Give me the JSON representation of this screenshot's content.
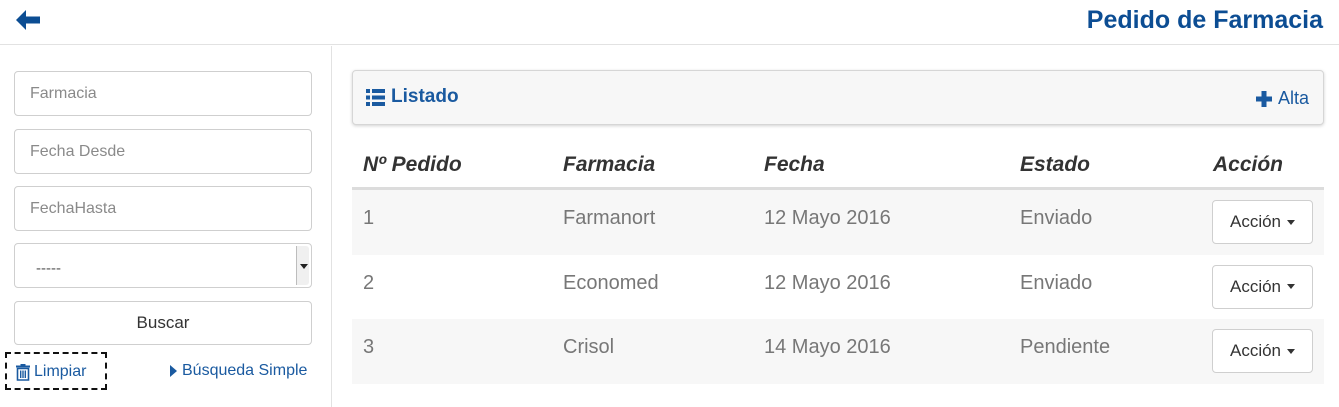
{
  "header": {
    "title": "Pedido de Farmacia",
    "back_icon": "arrow-left-icon"
  },
  "filters": {
    "farmacia_placeholder": "Farmacia",
    "fecha_desde_placeholder": "Fecha Desde",
    "fecha_hasta_placeholder": "FechaHasta",
    "estado_select_value": "-----",
    "buscar_label": "Buscar",
    "limpiar_label": "Limpiar",
    "busqueda_simple_label": "Búsqueda Simple"
  },
  "panel": {
    "title": "Listado",
    "alta_label": "Alta"
  },
  "table": {
    "columns": [
      "Nº Pedido",
      "Farmacia",
      "Fecha",
      "Estado",
      "Acción"
    ],
    "rows": [
      {
        "numero": "1",
        "farmacia": "Farmanort",
        "fecha": "12 Mayo 2016",
        "estado": "Enviado",
        "accion": "Acción"
      },
      {
        "numero": "2",
        "farmacia": "Economed",
        "fecha": "12 Mayo 2016",
        "estado": "Enviado",
        "accion": "Acción"
      },
      {
        "numero": "3",
        "farmacia": "Crisol",
        "fecha": "14 Mayo 2016",
        "estado": "Pendiente",
        "accion": "Acción"
      }
    ]
  },
  "colors": {
    "brand_blue": "#0c4d93",
    "link_blue": "#1a5aa0"
  }
}
